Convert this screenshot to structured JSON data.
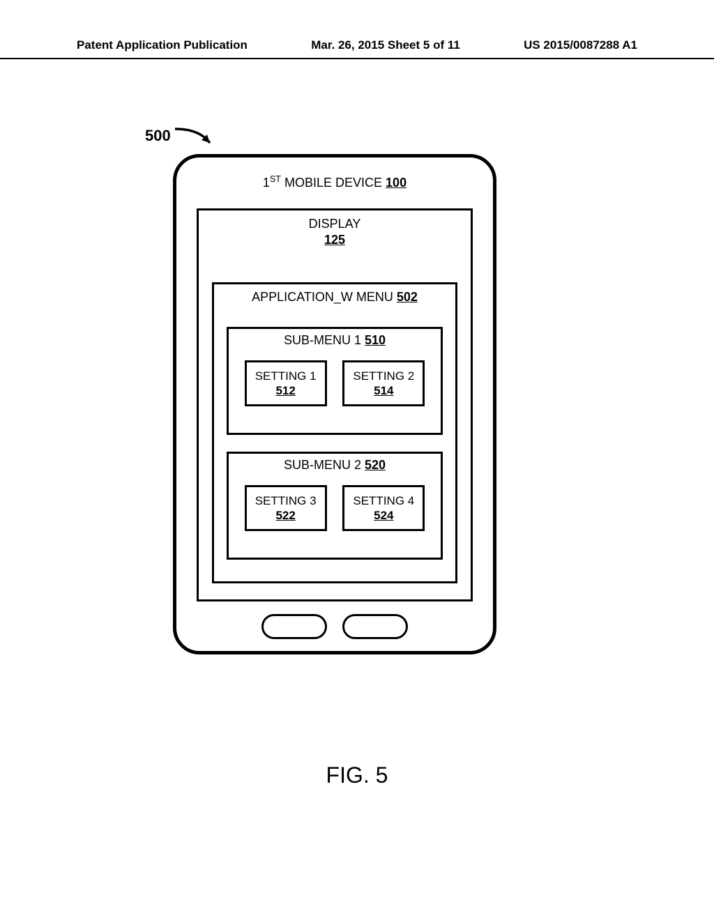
{
  "header": {
    "left": "Patent Application Publication",
    "center": "Mar. 26, 2015  Sheet 5 of 11",
    "right": "US 2015/0087288 A1"
  },
  "figure_ref": {
    "label": "500"
  },
  "device": {
    "title_prefix": "1",
    "title_sup": "ST",
    "title_rest": " MOBILE DEVICE ",
    "ref": "100"
  },
  "display": {
    "label": "DISPLAY",
    "ref": "125"
  },
  "app_menu": {
    "label": "APPLICATION_W MENU ",
    "ref": "502"
  },
  "submenus": [
    {
      "label": "SUB-MENU 1 ",
      "ref": "510",
      "settings": [
        {
          "label": "SETTING 1",
          "ref": "512"
        },
        {
          "label": "SETTING 2",
          "ref": "514"
        }
      ]
    },
    {
      "label": "SUB-MENU 2 ",
      "ref": "520",
      "settings": [
        {
          "label": "SETTING 3",
          "ref": "522"
        },
        {
          "label": "SETTING 4",
          "ref": "524"
        }
      ]
    }
  ],
  "caption": "FIG. 5"
}
